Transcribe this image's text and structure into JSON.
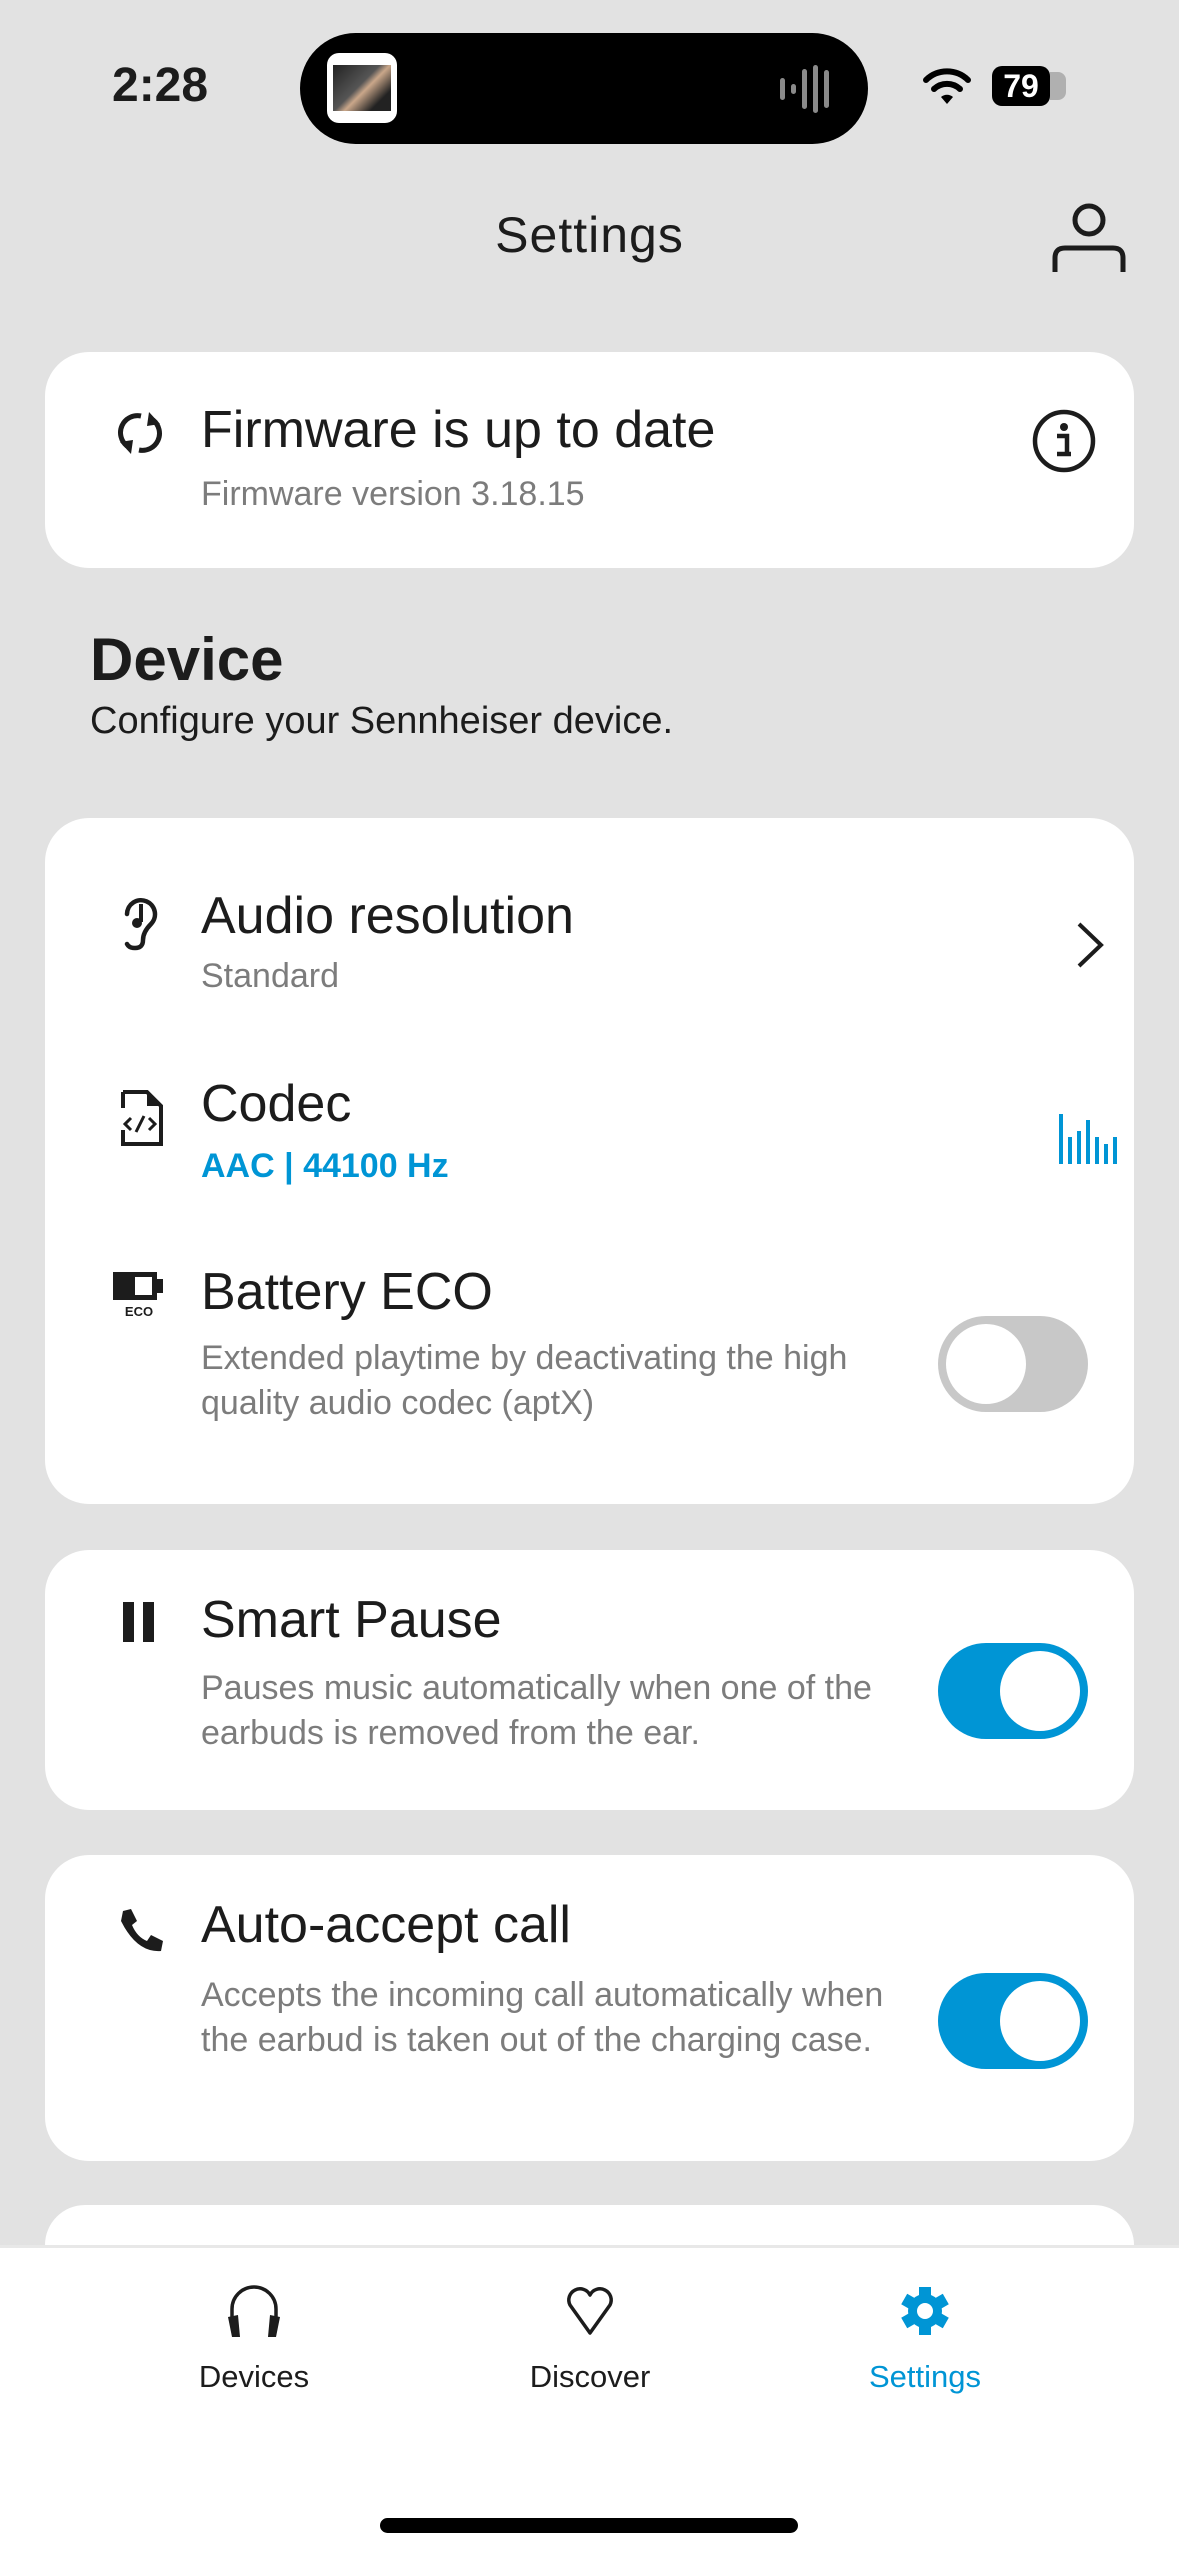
{
  "status_bar": {
    "time": "2:28",
    "battery_level": "79",
    "icons": [
      "now-playing-album-art",
      "audio-waveform-icon",
      "wifi-icon",
      "battery-icon"
    ]
  },
  "header": {
    "title": "Settings",
    "profile_icon": "person-icon"
  },
  "firmware": {
    "icon": "sync-icon",
    "title": "Firmware is up to date",
    "version": "Firmware version 3.18.15",
    "info_icon": "info-icon"
  },
  "device_section": {
    "title": "Device",
    "subtitle": "Configure your Sennheiser device.",
    "items": [
      {
        "icon": "ear-icon",
        "title": "Audio resolution",
        "subtitle": "Standard",
        "control": "chevron-right-icon"
      },
      {
        "icon": "code-file-icon",
        "title": "Codec",
        "subtitle": "AAC | 44100 Hz",
        "control": "equalizer-bars-icon"
      },
      {
        "icon": "battery-eco-icon",
        "icon_label": "ECO",
        "title": "Battery ECO",
        "subtitle": "Extended playtime by deactivating the high quality audio codec (aptX)",
        "toggle_on": false
      }
    ]
  },
  "smart_pause": {
    "icon": "pause-icon",
    "title": "Smart Pause",
    "subtitle": "Pauses music automatically when one of the earbuds is removed from the ear.",
    "toggle_on": true
  },
  "auto_accept": {
    "icon": "phone-icon",
    "title": "Auto-accept call",
    "subtitle": "Accepts the incoming call automatically when the earbud is taken out of the charging case.",
    "toggle_on": true
  },
  "tab_bar": {
    "tabs": [
      {
        "label": "Devices",
        "icon": "headphones-icon",
        "active": false
      },
      {
        "label": "Discover",
        "icon": "heart-icon",
        "active": false
      },
      {
        "label": "Settings",
        "icon": "gear-icon",
        "active": true
      }
    ]
  },
  "colors": {
    "accent": "#0095d5",
    "background": "#e2e2e2",
    "card": "#ffffff",
    "text_primary": "#1c1c1c",
    "text_secondary": "#7c7c7c",
    "toggle_off": "#c8c8c8"
  }
}
